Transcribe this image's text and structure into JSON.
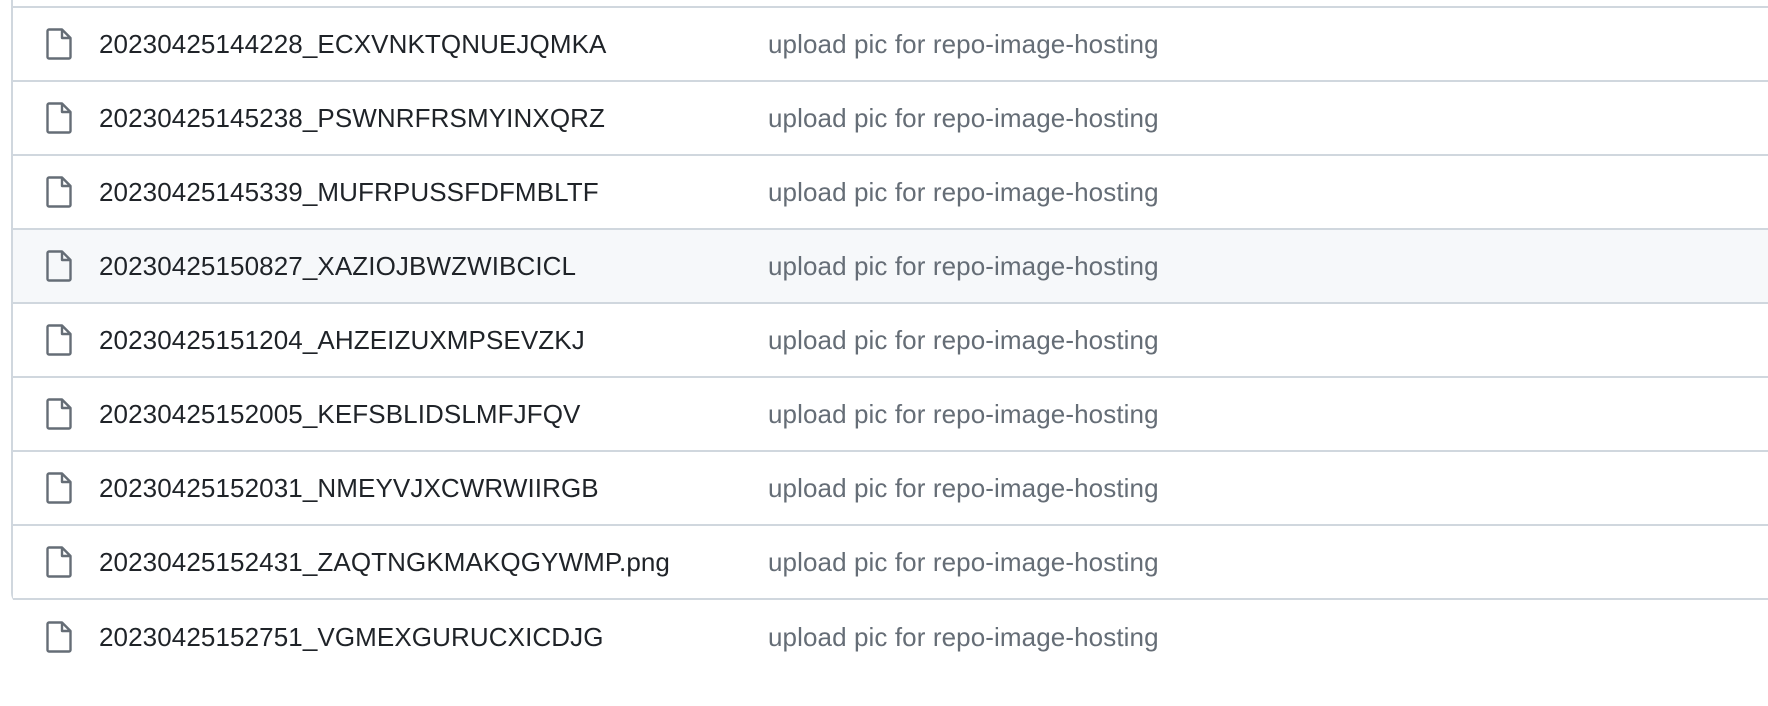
{
  "file_list": {
    "rows": [
      {
        "name": "20230425144228_ECXVNKTQNUEJQMKA",
        "commit_message": "upload pic for repo-image-hosting",
        "icon": "file-icon"
      },
      {
        "name": "20230425145238_PSWNRFRSMYINXQRZ",
        "commit_message": "upload pic for repo-image-hosting",
        "icon": "file-icon"
      },
      {
        "name": "20230425145339_MUFRPUSSFDFMBLTF",
        "commit_message": "upload pic for repo-image-hosting",
        "icon": "file-icon"
      },
      {
        "name": "20230425150827_XAZIOJBWZWIBCICL",
        "commit_message": "upload pic for repo-image-hosting",
        "icon": "file-icon"
      },
      {
        "name": "20230425151204_AHZEIZUXMPSEVZKJ",
        "commit_message": "upload pic for repo-image-hosting",
        "icon": "file-icon"
      },
      {
        "name": "20230425152005_KEFSBLIDSLMFJFQV",
        "commit_message": "upload pic for repo-image-hosting",
        "icon": "file-icon"
      },
      {
        "name": "20230425152031_NMEYVJXCWRWIIRGB",
        "commit_message": "upload pic for repo-image-hosting",
        "icon": "file-icon"
      },
      {
        "name": "20230425152431_ZAQTNGKMAKQGYWMP.png",
        "commit_message": "upload pic for repo-image-hosting",
        "icon": "file-icon"
      },
      {
        "name": "20230425152751_VGMEXGURUCXICDJG",
        "commit_message": "upload pic for repo-image-hosting",
        "icon": "file-icon"
      }
    ]
  },
  "colors": {
    "border": "#d0d7de",
    "text": "#1f2328",
    "muted_text": "#656d76",
    "icon": "#656d76",
    "hover_row": "#f6f8fa"
  }
}
